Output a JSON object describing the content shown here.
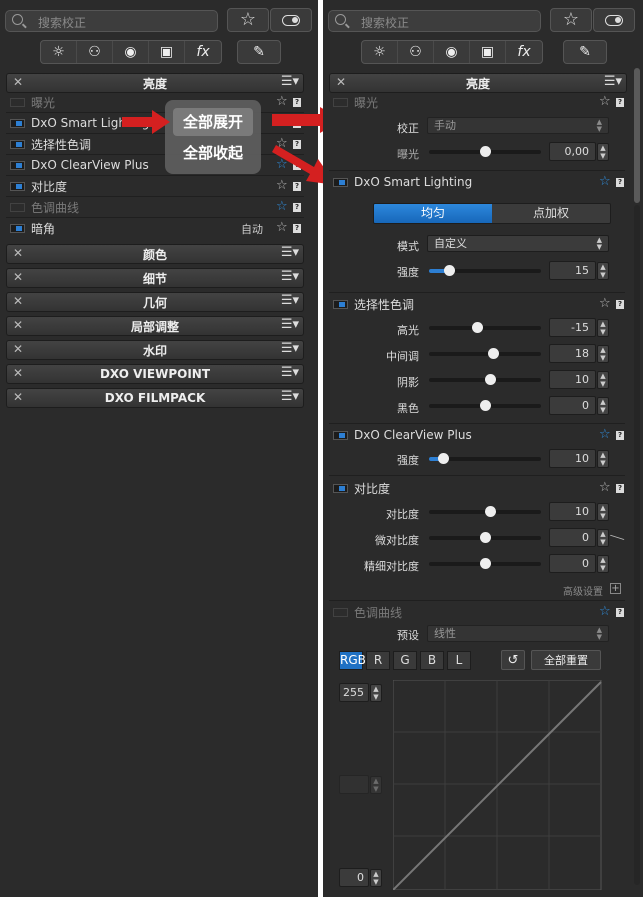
{
  "search": {
    "placeholder": "搜索校正"
  },
  "left": {
    "sections_top": {
      "title": "亮度"
    },
    "items": [
      {
        "label": "曝光",
        "enabled": false
      },
      {
        "label": "DxO Smart Lighting",
        "enabled": true
      },
      {
        "label": "选择性色调",
        "enabled": true
      },
      {
        "label": "DxO ClearView Plus",
        "enabled": true
      },
      {
        "label": "对比度",
        "enabled": true
      },
      {
        "label": "色调曲线",
        "enabled": false
      },
      {
        "label": "暗角",
        "enabled": true,
        "value": "自动"
      }
    ],
    "sections": [
      "颜色",
      "细节",
      "几何",
      "局部调整",
      "水印",
      "DXO VIEWPOINT",
      "DXO FILMPACK"
    ]
  },
  "popup": {
    "expand_all": "全部展开",
    "collapse_all": "全部收起"
  },
  "right": {
    "section_title": "亮度",
    "exposure": {
      "title": "曝光",
      "correction_label": "校正",
      "correction_value": "手动",
      "exposure_label": "曝光",
      "exposure_value": "0,00"
    },
    "smart_lighting": {
      "title": "DxO Smart Lighting",
      "tab_uniform": "均匀",
      "tab_spot": "点加权",
      "mode_label": "模式",
      "mode_value": "自定义",
      "intensity_label": "强度",
      "intensity_value": "15"
    },
    "selective_tone": {
      "title": "选择性色调",
      "highlights_label": "高光",
      "highlights_value": "-15",
      "midtones_label": "中间调",
      "midtones_value": "18",
      "shadows_label": "阴影",
      "shadows_value": "10",
      "blacks_label": "黑色",
      "blacks_value": "0"
    },
    "clearview": {
      "title": "DxO ClearView Plus",
      "intensity_label": "强度",
      "intensity_value": "10"
    },
    "contrast": {
      "title": "对比度",
      "contrast_label": "对比度",
      "contrast_value": "10",
      "micro_label": "微对比度",
      "micro_value": "0",
      "fine_label": "精细对比度",
      "fine_value": "0",
      "advanced": "高级设置"
    },
    "tone_curve": {
      "title": "色调曲线",
      "preset_label": "预设",
      "preset_value": "线性",
      "channels": [
        "RGB",
        "R",
        "G",
        "B",
        "L"
      ],
      "reset_all": "全部重置",
      "top_value": "255",
      "bottom_value": "0"
    }
  },
  "colors": {
    "accent": "#2d7fd3",
    "arrow": "#d42020",
    "panel": "#2b2b2b"
  }
}
